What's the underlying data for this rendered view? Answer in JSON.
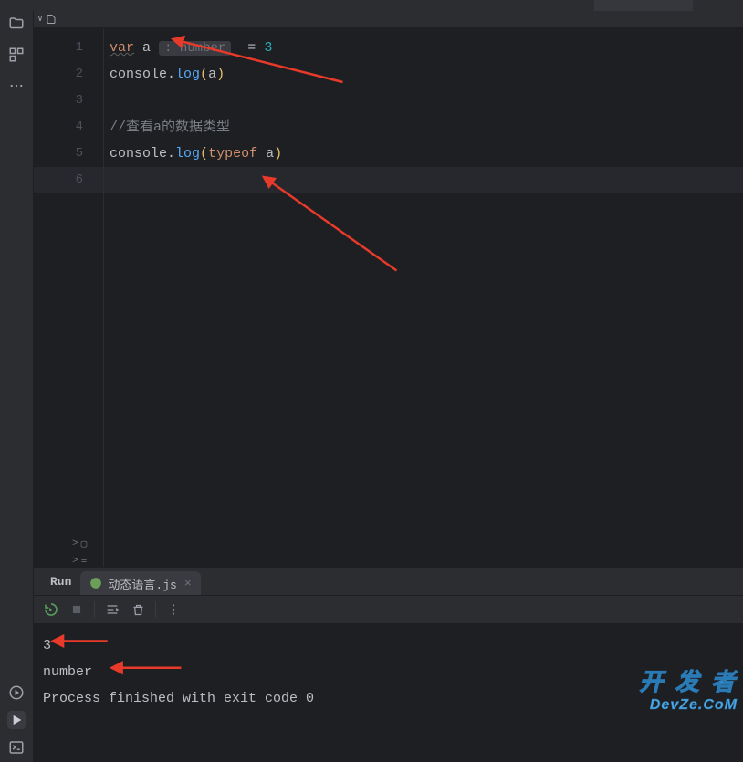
{
  "tabs_top": {
    "active_indicator": ""
  },
  "project_row": {
    "chevron": "∨",
    "icon_hint": "file"
  },
  "gutter_lines": [
    "1",
    "2",
    "3",
    "4",
    "5",
    "6"
  ],
  "code": {
    "l1": {
      "var": "var",
      "sp1": " ",
      "id": "a",
      "sp2": " ",
      "hint": ": number",
      "sp3": "  ",
      "eq": "=",
      "sp4": " ",
      "val": "3"
    },
    "l2": {
      "obj": "console",
      "dot": ".",
      "fn": "log",
      "po": "(",
      "arg": "a",
      "pc": ")"
    },
    "l3": "",
    "l4": {
      "comment": "//查看a的数据类型"
    },
    "l5": {
      "obj": "console",
      "dot": ".",
      "fn": "log",
      "po": "(",
      "kw": "typeof",
      "sp": " ",
      "arg": "a",
      "pc": ")"
    },
    "l6": ""
  },
  "folds": [
    ">",
    ">"
  ],
  "fold_icons": [
    "▢",
    "≡"
  ],
  "run_panel": {
    "tab_run": "Run",
    "tab_file": "动态语言.js",
    "output_lines": {
      "o1": "3",
      "o2": "number",
      "o3": "",
      "o4": "Process finished with exit code 0"
    }
  },
  "toolbar_titles": {
    "rerun": "Rerun",
    "stop": "Stop",
    "layout": "Layout",
    "trash": "Delete",
    "more": "More"
  },
  "watermark": {
    "line1": "开 发 者",
    "line2": "DevZe.CoM"
  }
}
